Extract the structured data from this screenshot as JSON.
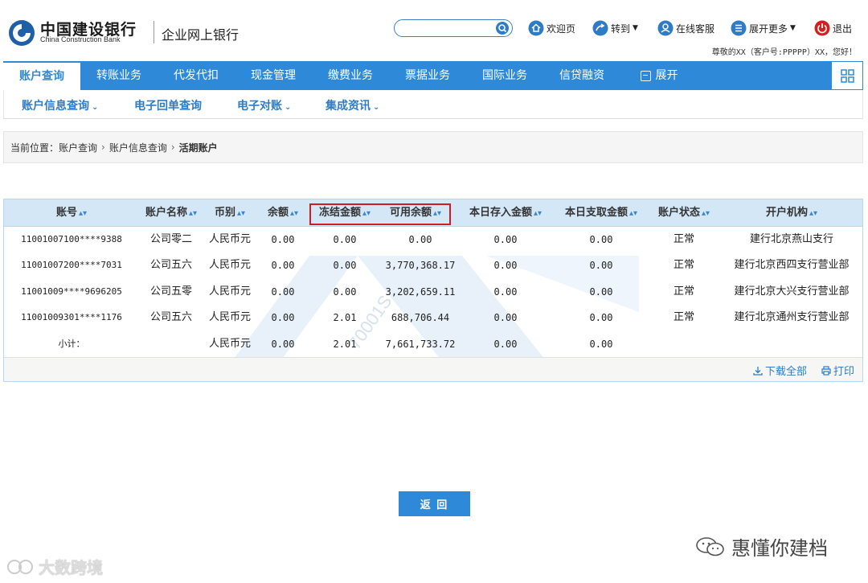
{
  "brand": {
    "name_cn": "中国建设银行",
    "name_en": "China Construction Bank",
    "subtitle": "企业网上银行"
  },
  "topbar": {
    "search_placeholder": "",
    "links": [
      {
        "label": "欢迎页",
        "icon": "home-icon"
      },
      {
        "label": "转到",
        "icon": "goto-icon",
        "dropdown": true
      },
      {
        "label": "在线客服",
        "icon": "customer-service-icon"
      },
      {
        "label": "展开更多",
        "icon": "more-icon",
        "dropdown": true
      },
      {
        "label": "退出",
        "icon": "power-icon"
      }
    ],
    "greeting": "尊敬的XX（客户号:PPPPP）XX，您好！"
  },
  "nav": {
    "items": [
      "账户查询",
      "转账业务",
      "代发代扣",
      "现金管理",
      "缴费业务",
      "票据业务",
      "国际业务",
      "信贷融资",
      "展开"
    ],
    "active_index": 0
  },
  "subnav": {
    "items": [
      "账户信息查询",
      "电子回单查询",
      "电子对账",
      "集成资讯"
    ],
    "dropdown_flags": [
      true,
      false,
      true,
      true
    ]
  },
  "breadcrumb": {
    "prefix": "当前位置：",
    "items": [
      "账户查询",
      "账户信息查询",
      "活期账户"
    ]
  },
  "table": {
    "columns": [
      "账号",
      "账户名称",
      "币别",
      "余额",
      "冻结金额",
      "可用余额",
      "本日存入金额",
      "本日支取金额",
      "账户状态",
      "开户机构"
    ],
    "rows": [
      [
        "11001007100****9388",
        "公司零二",
        "人民币元",
        "0.00",
        "0.00",
        "0.00",
        "0.00",
        "0.00",
        "正常",
        "建行北京燕山支行"
      ],
      [
        "11001007200****7031",
        "公司五六",
        "人民币元",
        "0.00",
        "0.00",
        "3,770,368.17",
        "0.00",
        "0.00",
        "正常",
        "建行北京西四支行营业部"
      ],
      [
        "11001009****9696205",
        "公司五零",
        "人民币元",
        "0.00",
        "0.00",
        "3,202,659.11",
        "0.00",
        "0.00",
        "正常",
        "建行北京大兴支行营业部"
      ],
      [
        "11001009301****1176",
        "公司五六",
        "人民币元",
        "0.00",
        "2.01",
        "688,706.44",
        "0.00",
        "0.00",
        "正常",
        "建行北京通州支行营业部"
      ],
      [
        "小计：",
        "",
        "人民币元",
        "0.00",
        "2.01",
        "7,661,733.72",
        "0.00",
        "0.00",
        "",
        ""
      ]
    ],
    "footer": {
      "download_all": "下载全部",
      "print": "打印"
    },
    "watermark_text": "70001S"
  },
  "actions": {
    "back": "返 回"
  },
  "watermarks": {
    "right": "惠懂你建档",
    "left": "大数跨境"
  },
  "colors": {
    "primary": "#2e8ad8",
    "header_bg": "#d3e7f7",
    "highlight": "#d01c24"
  }
}
